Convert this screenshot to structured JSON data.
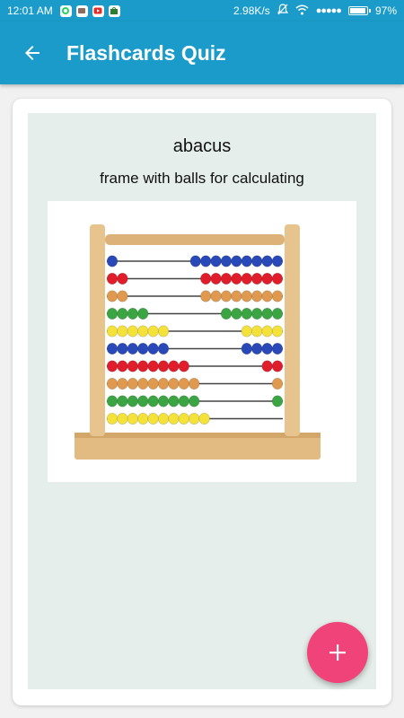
{
  "status_bar": {
    "time": "12:01 AM",
    "network_speed": "2.98K/s",
    "signal_dots": "●●●●●",
    "battery": "97%",
    "app_icons": [
      "whatsapp-icon",
      "gallery-icon",
      "youtube-icon",
      "store-icon"
    ]
  },
  "app_bar": {
    "title": "Flashcards Quiz",
    "back_icon": "arrow-back-icon",
    "color": "#1a9bc9"
  },
  "card": {
    "word": "abacus",
    "definition": "frame with balls for calculating",
    "image": "abacus-image",
    "background": "#e5eeea"
  },
  "fab": {
    "icon": "plus-icon",
    "color": "#f0437a"
  }
}
